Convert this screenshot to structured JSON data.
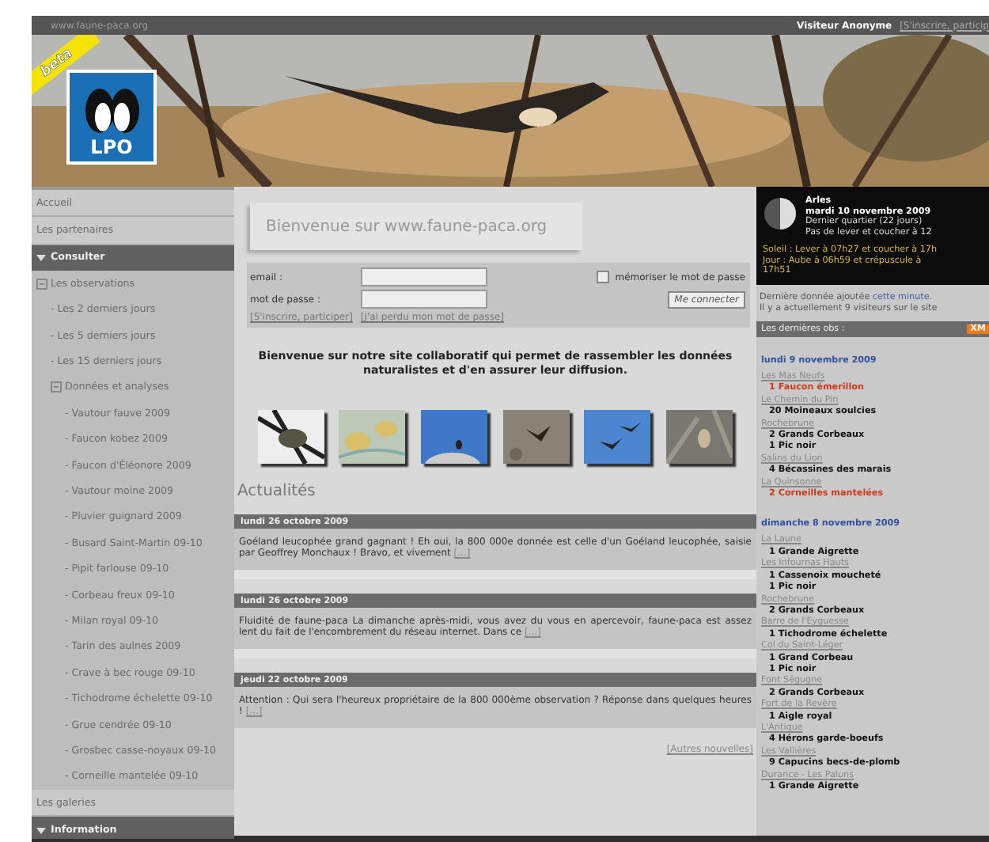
{
  "top_bar": {
    "site": "www.faune-paca.org",
    "visitor": "Visiteur Anonyme",
    "signup": "[S'inscrire, particip"
  },
  "banner": {
    "ribbon": "beta",
    "logo": "LPO"
  },
  "sidebar": {
    "items": [
      {
        "label": "Accueil",
        "kind": "link"
      },
      {
        "label": "Les partenaires",
        "kind": "link"
      },
      {
        "label": "Consulter",
        "kind": "header"
      },
      {
        "label": "Les observations",
        "kind": "node",
        "children": [
          {
            "label": "- Les 2 derniers jours",
            "kind": "link"
          },
          {
            "label": "- Les 5 derniers jours",
            "kind": "link"
          },
          {
            "label": "- Les 15 derniers jours",
            "kind": "link"
          },
          {
            "label": "Données et analyses",
            "kind": "node",
            "children": [
              {
                "label": "- Vautour fauve 2009",
                "kind": "link"
              },
              {
                "label": "- Faucon kobez 2009",
                "kind": "link"
              },
              {
                "label": "- Faucon d'Éléonore 2009",
                "kind": "link"
              },
              {
                "label": "- Vautour moine 2009",
                "kind": "link"
              },
              {
                "label": "- Pluvier guignard 2009",
                "kind": "link"
              },
              {
                "label": "- Busard Saint-Martin 09-10",
                "kind": "link"
              },
              {
                "label": "- Pipit farlouse 09-10",
                "kind": "link"
              },
              {
                "label": "- Corbeau freux 09-10",
                "kind": "link"
              },
              {
                "label": "- Milan royal 09-10",
                "kind": "link"
              },
              {
                "label": "- Tarin des aulnes 2009",
                "kind": "link"
              },
              {
                "label": "- Crave à bec rouge 09-10",
                "kind": "link"
              },
              {
                "label": "- Tichodrome échelette 09-10",
                "kind": "link"
              },
              {
                "label": "- Grue cendrée 09-10",
                "kind": "link"
              },
              {
                "label": "- Grosbec casse-noyaux 09-10",
                "kind": "link"
              },
              {
                "label": "- Corneille mantelée 09-10",
                "kind": "link"
              }
            ]
          }
        ]
      },
      {
        "label": "Les galeries",
        "kind": "link"
      },
      {
        "label": "Information",
        "kind": "header"
      }
    ]
  },
  "main": {
    "welcome": "Bienvenue sur www.faune-paca.org",
    "login": {
      "email_label": "email :",
      "password_label": "mot de passe :",
      "remember": {
        "label": "mémoriser le mot de passe",
        "checked": false
      },
      "submit": "Me connecter",
      "links": [
        "[S'inscrire, participer]",
        "[J'ai perdu mon mot de passe]"
      ]
    },
    "intro": "Bienvenue sur notre site collaboratif qui permet de rassembler les données naturalistes et d'en assurer leur diffusion.",
    "news_title": "Actualités",
    "news": [
      {
        "date": "lundi 26 octobre 2009",
        "text": "Goéland leucophée grand gagnant ! Eh oui, la 800 000e donnée est celle d'un Goéland leucophée, saisie par Geoffrey Monchaux ! Bravo, et vivement",
        "more": "[...]"
      },
      {
        "date": "lundi 26 octobre 2009",
        "text": "Fluidité de faune-paca La dimanche après-midi, vous avez du vous en apercevoir, faune-paca est assez lent du fait de l'encombrement du réseau internet. Dans ce",
        "more": "[...]"
      },
      {
        "date": "jeudi 22 octobre 2009",
        "text": "Attention : Qui sera l'heureux propriétaire de la 800 000ème observation ? Réponse dans quelques heures !",
        "more": "[...]"
      }
    ],
    "more_news": "[Autres nouvelles]"
  },
  "right": {
    "ephemeris": {
      "town": "Arles",
      "date": "mardi 10 novembre 2009",
      "moon": "Dernier quartier (22 jours)",
      "moon_times": "Pas de lever et coucher à 12",
      "sun": "Soleil : Lever à 07h27 et coucher à 17h",
      "day": "Jour : Aube à 06h59 et crépuscule à 17h51"
    },
    "last_data": "Dernière donnée ajoutée",
    "last_data_link": "cette minute.",
    "visitors": "Il y a actuellement 9 visiteurs sur le site",
    "obs_title": "Les dernières obs :",
    "xml": "XM",
    "days": [
      {
        "date": "lundi 9 novembre 2009",
        "places": [
          {
            "name": "Les Mas Neufs",
            "sightings": [
              {
                "text": "1 Faucon émerillon",
                "rare": true
              }
            ]
          },
          {
            "name": "Le Chemin du Pin",
            "sightings": [
              {
                "text": "20 Moineaux soulcies",
                "rare": false
              }
            ]
          },
          {
            "name": "Rochebrune",
            "sightings": [
              {
                "text": "2 Grands Corbeaux",
                "rare": false
              },
              {
                "text": "1 Pic noir",
                "rare": false
              }
            ]
          },
          {
            "name": "Salins du Lion",
            "sightings": [
              {
                "text": "4 Bécassines des marais",
                "rare": false
              }
            ]
          },
          {
            "name": "La Quinsonne",
            "sightings": [
              {
                "text": "2 Corneilles mantelées",
                "rare": true
              }
            ]
          }
        ]
      },
      {
        "date": "dimanche 8 novembre 2009",
        "places": [
          {
            "name": "La Laune",
            "sightings": [
              {
                "text": "1 Grande Aigrette",
                "rare": false
              }
            ]
          },
          {
            "name": "Les Infournas Hauts",
            "sightings": [
              {
                "text": "1 Cassenoix moucheté",
                "rare": false
              },
              {
                "text": "1 Pic noir",
                "rare": false
              }
            ]
          },
          {
            "name": "Rochebrune",
            "sightings": [
              {
                "text": "2 Grands Corbeaux",
                "rare": false
              }
            ]
          },
          {
            "name": "Barre de l'Eyguesse",
            "sightings": [
              {
                "text": "1 Tichodrome échelette",
                "rare": false
              }
            ]
          },
          {
            "name": "Col du Saint-Léger",
            "sightings": [
              {
                "text": "1 Grand Corbeau",
                "rare": false
              },
              {
                "text": "1 Pic noir",
                "rare": false
              }
            ]
          },
          {
            "name": "Font Ségugne",
            "sightings": [
              {
                "text": "2 Grands Corbeaux",
                "rare": false
              }
            ]
          },
          {
            "name": "Fort de la Revère",
            "sightings": [
              {
                "text": "1 Aigle royal",
                "rare": false
              }
            ]
          },
          {
            "name": "L'Antique",
            "sightings": [
              {
                "text": "4 Hérons garde-boeufs",
                "rare": false
              }
            ]
          },
          {
            "name": "Les Vallières",
            "sightings": [
              {
                "text": "9 Capucins becs-de-plomb",
                "rare": false
              }
            ]
          },
          {
            "name": "Durance - Les Paluns",
            "sightings": [
              {
                "text": "1 Grande Aigrette",
                "rare": false
              }
            ]
          }
        ]
      }
    ]
  }
}
